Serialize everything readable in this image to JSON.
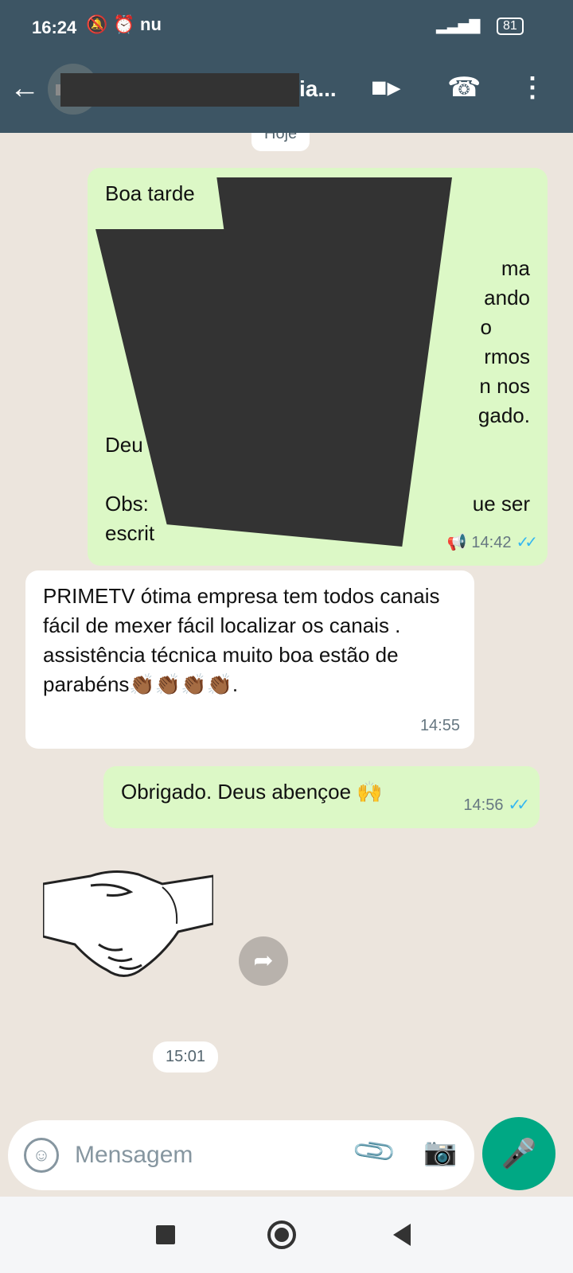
{
  "status_bar": {
    "time": "16:24",
    "carrier_icon": "nu",
    "battery": "81"
  },
  "header": {
    "contact_name": "ia...",
    "icons": [
      "back-arrow-icon",
      "video-call-icon",
      "phone-icon",
      "more-vert-icon"
    ]
  },
  "chat": {
    "day_label": "Hoje",
    "messages": [
      {
        "direction": "out",
        "lines": [
          "Boa tarde",
          "",
          "",
          "ma",
          "ando",
          "o",
          "rmos",
          "n nos",
          "gado.",
          "Deu",
          "",
          "Obs:",
          "ue ser",
          "escrit"
        ],
        "time": "14:42",
        "status": "read"
      },
      {
        "direction": "in",
        "text": "PRIMETV ótima empresa tem todos canais fácil de mexer fácil localizar os canais . assistência técnica muito boa estão de parabéns👏🏾👏🏾👏🏾👏🏾.",
        "time": "14:55"
      },
      {
        "direction": "out",
        "text": "Obrigado. Deus abençoe 🙌",
        "time": "14:56",
        "status": "read"
      },
      {
        "direction": "out",
        "type": "sticker",
        "sticker": "handshake",
        "time": "15:01"
      }
    ]
  },
  "composer": {
    "placeholder": "Mensagem"
  },
  "colors": {
    "header_bg": "#3d5564",
    "outgoing_bubble": "#dcf8c6",
    "incoming_bubble": "#ffffff",
    "accent": "#00a884",
    "read_ticks": "#34b7f1"
  }
}
